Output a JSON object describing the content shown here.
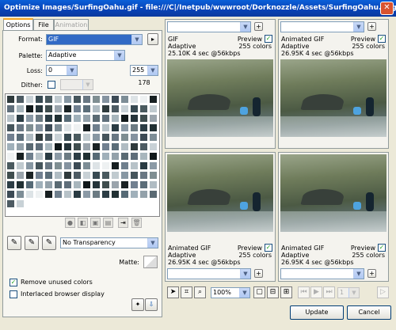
{
  "window": {
    "title": "Optimize Images/SurfingOahu.gif - file:///C|/Inetpub/wwwroot/Dorknozzle/Assets/SurfingOahu.png"
  },
  "tabs": [
    {
      "label": "Options"
    },
    {
      "label": "File"
    },
    {
      "label": "Animation"
    }
  ],
  "options": {
    "format_label": "Format:",
    "format_value": "GIF",
    "palette_label": "Palette:",
    "palette_value": "Adaptive",
    "loss_label": "Loss:",
    "loss_value": "0",
    "colors_value": "255",
    "colors_count": "178",
    "dither_label": "Dither:",
    "transparency_value": "No Transparency",
    "matte_label": "Matte:",
    "remove_unused_label": "Remove unused colors",
    "interlaced_label": "Interlaced browser display"
  },
  "previews": [
    {
      "format": "GIF",
      "palette": "Adaptive",
      "size": "25.10K",
      "time": "4 sec @56kbps",
      "preview_label": "Preview",
      "colors": "255 colors"
    },
    {
      "format": "Animated GIF",
      "palette": "Adaptive",
      "size": "26.95K",
      "time": "4 sec @56kbps",
      "preview_label": "Preview",
      "colors": "255 colors"
    },
    {
      "format": "Animated GIF",
      "palette": "Adaptive",
      "size": "26.95K",
      "time": "4 sec @56kbps",
      "preview_label": "Preview",
      "colors": "255 colors"
    },
    {
      "format": "Animated GIF",
      "palette": "Adaptive",
      "size": "26.95K",
      "time": "4 sec @56kbps",
      "preview_label": "Preview",
      "colors": "255 colors"
    }
  ],
  "toolbar": {
    "zoom_value": "100%",
    "frame_value": "1"
  },
  "buttons": {
    "update": "Update",
    "cancel": "Cancel"
  },
  "palette_colors": [
    "#2f3a3c",
    "#6f7f8d",
    "#9aa4ac",
    "#3c4a55",
    "#5f6e7a",
    "#8797a3",
    "#213033",
    "#4d5b63",
    "#b7c2c8",
    "#1a2224",
    "#7d8d96",
    "#a8b6bd",
    "#46555c",
    "#566a76",
    "#c8d1d6",
    "#2a3b43",
    "#718090",
    "#dde3e6",
    "#10181a",
    "#697783",
    "#a0b0ba",
    "#384a52",
    "#8b9aa6",
    "#5b6d79",
    "#eef1f2",
    "#25343a",
    "#7f8e92",
    "#93a1aa",
    "#4a5a5f",
    "#6c7b83",
    "#b0bcc3",
    "#171f21",
    "#3f4d4e",
    "#8593a0",
    "#5a6a73",
    "#c0cacf",
    "#2c3d45"
  ]
}
